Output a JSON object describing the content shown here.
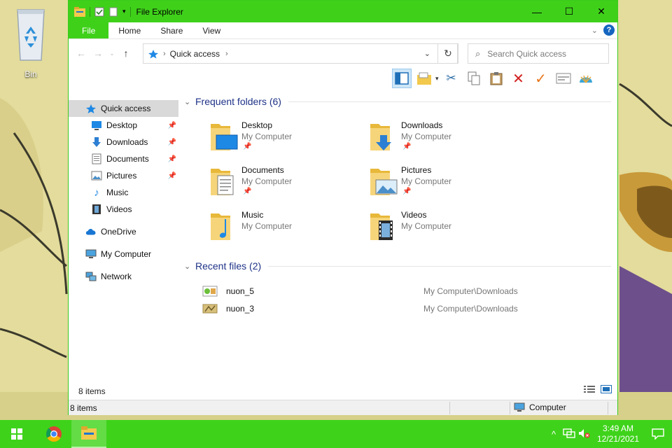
{
  "desktop": {
    "recycle_bin_label": "Bin"
  },
  "window": {
    "title": "File Explorer",
    "controls": {
      "minimize": "—",
      "maximize": "☐",
      "close": "✕"
    }
  },
  "ribbon": {
    "tabs": [
      "File",
      "Home",
      "Share",
      "View"
    ],
    "help": "?"
  },
  "address": {
    "location": "Quick access",
    "search_placeholder": "Search Quick access"
  },
  "navpane": {
    "items": [
      {
        "label": "Quick access",
        "icon": "star-icon",
        "pinned": false,
        "selected": true
      },
      {
        "label": "Desktop",
        "icon": "desktop-icon",
        "pinned": true
      },
      {
        "label": "Downloads",
        "icon": "download-arrow-icon",
        "pinned": true
      },
      {
        "label": "Documents",
        "icon": "document-icon",
        "pinned": true
      },
      {
        "label": "Pictures",
        "icon": "pictures-icon",
        "pinned": true
      },
      {
        "label": "Music",
        "icon": "music-note-icon",
        "pinned": false
      },
      {
        "label": "Videos",
        "icon": "film-icon",
        "pinned": false
      },
      {
        "label": "OneDrive",
        "icon": "cloud-icon",
        "pinned": false
      },
      {
        "label": "My Computer",
        "icon": "computer-icon",
        "pinned": false
      },
      {
        "label": "Network",
        "icon": "network-icon",
        "pinned": false
      }
    ]
  },
  "frequent": {
    "header": "Frequent folders (6)",
    "folders": [
      {
        "name": "Desktop",
        "location": "My Computer",
        "pinned": true
      },
      {
        "name": "Downloads",
        "location": "My Computer",
        "pinned": true
      },
      {
        "name": "Documents",
        "location": "My Computer",
        "pinned": true
      },
      {
        "name": "Pictures",
        "location": "My Computer",
        "pinned": true
      },
      {
        "name": "Music",
        "location": "My Computer",
        "pinned": false
      },
      {
        "name": "Videos",
        "location": "My Computer",
        "pinned": false
      }
    ]
  },
  "recent": {
    "header": "Recent files (2)",
    "files": [
      {
        "name": "nuon_5",
        "path": "My Computer\\Downloads"
      },
      {
        "name": "nuon_3",
        "path": "My Computer\\Downloads"
      }
    ]
  },
  "status": {
    "inner_count": "8 items",
    "bar_count": "8 items",
    "zone": "Computer"
  },
  "taskbar": {
    "time": "3:49 AM",
    "date": "12/21/2021"
  },
  "colors": {
    "accent": "#3fd11a",
    "group_title": "#1e3287"
  }
}
